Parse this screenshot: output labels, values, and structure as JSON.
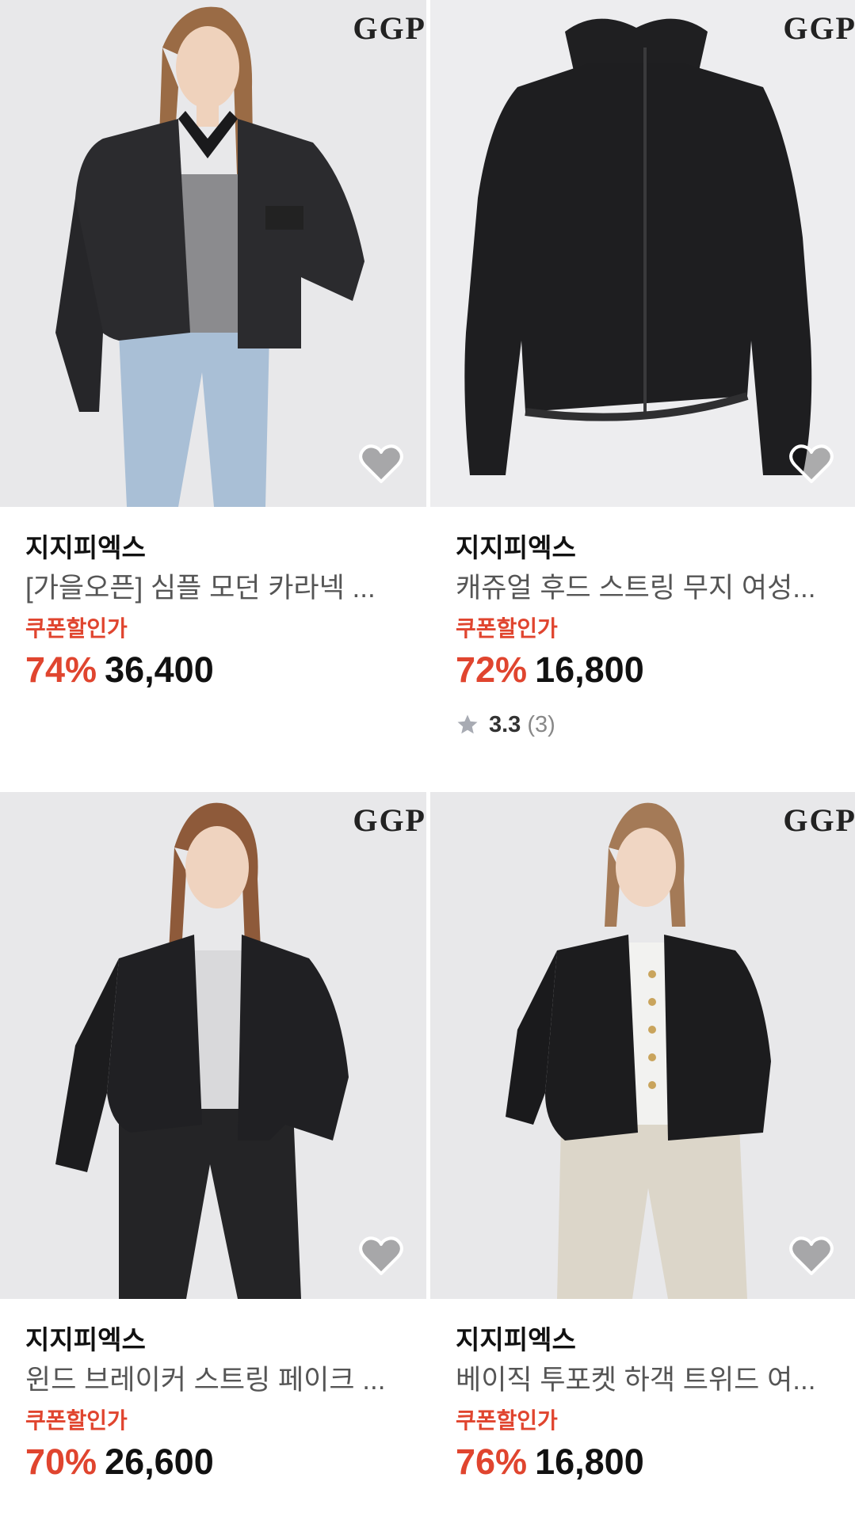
{
  "products": [
    {
      "logo": "GGP",
      "brand": "지지피엑스",
      "title": "[가을오픈] 심플 모던 카라넥 ...",
      "coupon_label": "쿠폰할인가",
      "discount": "74%",
      "price": "36,400"
    },
    {
      "logo": "GGP",
      "brand": "지지피엑스",
      "title": "캐쥬얼 후드 스트링 무지 여성...",
      "coupon_label": "쿠폰할인가",
      "discount": "72%",
      "price": "16,800",
      "rating": "3.3",
      "review_count": "(3)"
    },
    {
      "logo": "GGP",
      "brand": "지지피엑스",
      "title": "윈드 브레이커 스트링 페이크 ...",
      "coupon_label": "쿠폰할인가",
      "discount": "70%",
      "price": "26,600"
    },
    {
      "logo": "GGP",
      "brand": "지지피엑스",
      "title": "베이직 투포켓 하객 트위드 여...",
      "coupon_label": "쿠폰할인가",
      "discount": "76%",
      "price": "16,800"
    }
  ],
  "colors": {
    "discount_red": "#e0452f",
    "image_bg": "#e9e9eb",
    "jacket_black": "#1c1c1e"
  },
  "icons": {
    "wishlist": "heart-icon",
    "rating": "star-icon"
  }
}
